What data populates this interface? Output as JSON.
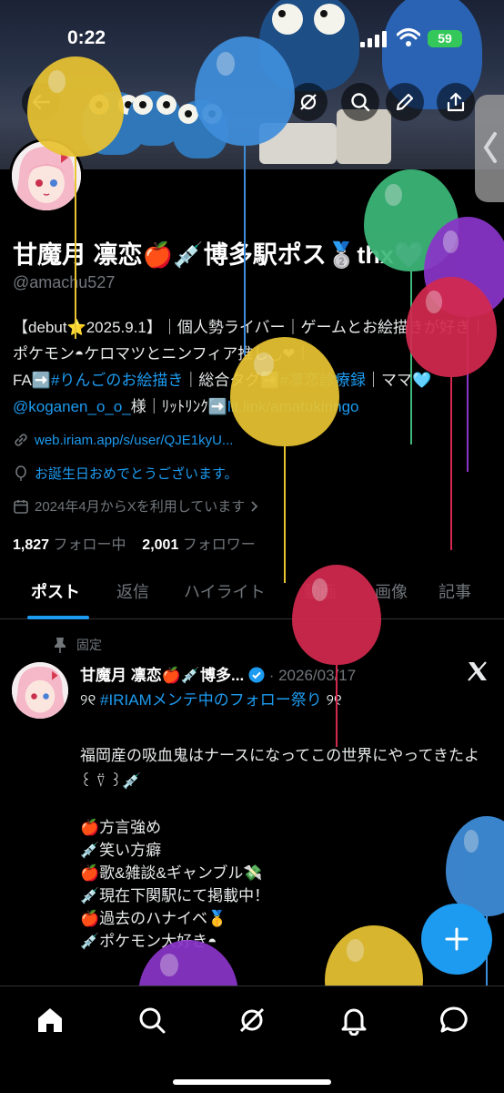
{
  "status_bar": {
    "time": "0:22",
    "battery": "59"
  },
  "profile": {
    "display_name": "甘魔月 凛恋🍎💉博多駅ポス🥈thx💜",
    "handle": "@amachu527",
    "bio_line1": "【debut⭐2025.9.1】｜個人勢ライバー｜ゲームとお絵描きが好き｜ポケモン◓ケロマツとニンフィア推し◡❤︎｜",
    "bio_line2_prefix": "FA➡️",
    "bio_tag_fa": "#りんごのお絵描き",
    "bio_line2_mid": "｜総合タグ➡️",
    "bio_tag_general": "#凛恋診療録",
    "bio_line2_suffix": "｜ママ🩵",
    "bio_mention": "@koganen_o_o_",
    "bio_line3_mid": "様｜ﾘｯﾄﾘﾝｸ➡️",
    "bio_link": "lit.link/amatukiringo",
    "website": "web.iriam.app/s/user/QJE1kyU...",
    "birthday_text": "お誕生日おめでとうございます。",
    "joined": "2024年4月からXを利用しています",
    "following_count": "1,827",
    "following_label": "フォロー中",
    "followers_count": "2,001",
    "followers_label": "フォロワー"
  },
  "tabs": [
    "ポスト",
    "返信",
    "ハイライト",
    "動画",
    "画像",
    "記事"
  ],
  "pinned_post": {
    "pinned_label": "固定",
    "author": "甘魔月 凛恋🍎💉博多...",
    "date": "· 2026/03/17",
    "line_hashtag_prefix": "୨୧ ",
    "hashtag": "#IRIAMメンテ中のフォロー祭り",
    "line_hashtag_suffix": " ୨୧",
    "para1": "福岡産の吸血鬼はナースになってこの世界にやってきたよ꒰ ⍢ ꒱💉",
    "list": [
      "🍎方言強め",
      "💉笑い方癖",
      "🍎歌&雑談&ギャンブル💸",
      "💉現在下関駅にて掲載中！",
      "🍎過去のハナイベ🥇",
      "💉ポケモン大好き◓"
    ]
  },
  "colors": {
    "accent": "#1d9bf0",
    "background": "#000000",
    "muted": "#71767b"
  },
  "icons": [
    "back-arrow-icon",
    "grok-icon",
    "search-icon",
    "pencil-icon",
    "share-icon",
    "verified-icon",
    "x-logo-icon",
    "pin-icon",
    "link-icon",
    "balloon-icon",
    "calendar-icon",
    "home-icon",
    "explore-icon",
    "grok-nav-icon",
    "bell-icon",
    "messages-icon",
    "compose-plus-icon"
  ]
}
